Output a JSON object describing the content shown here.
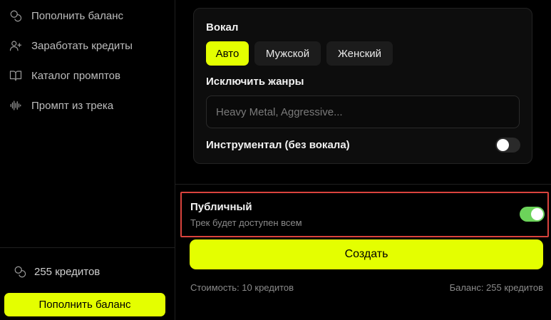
{
  "sidebar": {
    "items": [
      {
        "label": "Пополнить баланс",
        "icon": "coins-icon"
      },
      {
        "label": "Заработать кредиты",
        "icon": "user-plus-icon"
      },
      {
        "label": "Каталог промптов",
        "icon": "book-open-icon"
      },
      {
        "label": "Промпт из трека",
        "icon": "audio-wave-icon"
      }
    ],
    "credits_text": "255 кредитов",
    "topup_label": "Пополнить баланс"
  },
  "vocal": {
    "title": "Вокал",
    "options": [
      "Авто",
      "Мужской",
      "Женский"
    ],
    "selected": "Авто"
  },
  "exclude_genres": {
    "title": "Исключить жанры",
    "value": "",
    "placeholder": "Heavy Metal, Aggressive..."
  },
  "instrumental": {
    "label": "Инструментал (без вокала)",
    "enabled": false
  },
  "public": {
    "title": "Публичный",
    "subtitle": "Трек будет доступен всем",
    "enabled": true
  },
  "create_label": "Создать",
  "cost_text": "Стоимость: 10 кредитов",
  "balance_text": "Баланс: 255 кредитов",
  "colors": {
    "accent": "#e4ff00",
    "toggle_on": "#6cd35a",
    "highlight_border": "#d9433d"
  }
}
